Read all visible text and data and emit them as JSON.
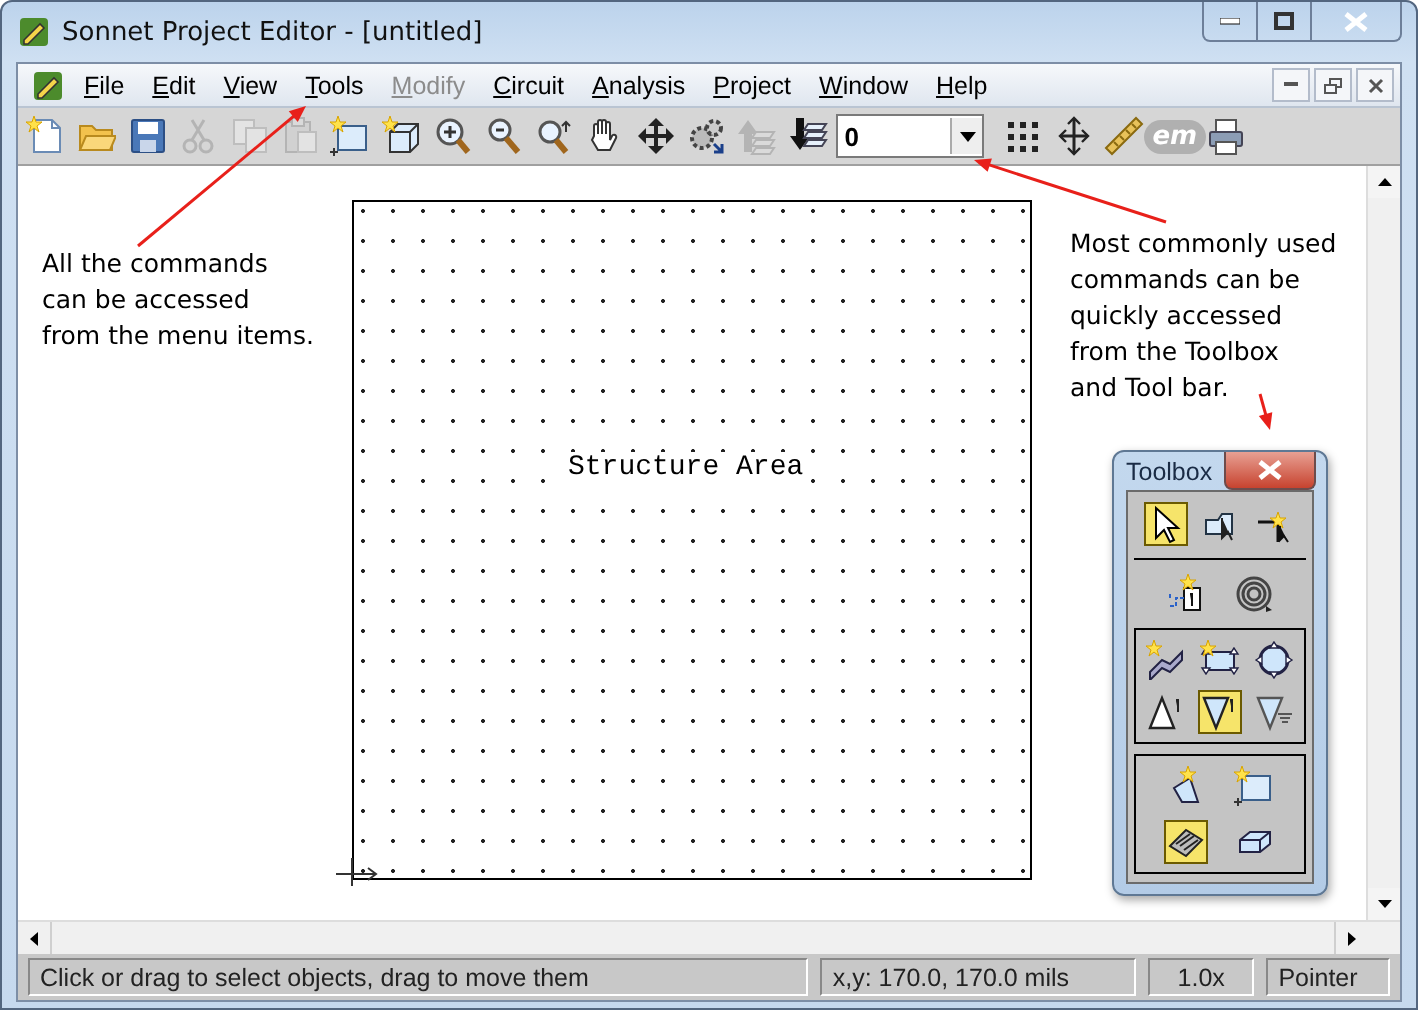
{
  "window": {
    "title": "Sonnet Project Editor - [untitled]"
  },
  "menu": [
    {
      "label": "File",
      "disabled": false
    },
    {
      "label": "Edit",
      "disabled": false
    },
    {
      "label": "View",
      "disabled": false
    },
    {
      "label": "Tools",
      "disabled": false
    },
    {
      "label": "Modify",
      "disabled": true
    },
    {
      "label": "Circuit",
      "disabled": false
    },
    {
      "label": "Analysis",
      "disabled": false
    },
    {
      "label": "Project",
      "disabled": false
    },
    {
      "label": "Window",
      "disabled": false
    },
    {
      "label": "Help",
      "disabled": false
    }
  ],
  "toolbar": [
    {
      "kind": "new",
      "disabled": false
    },
    {
      "kind": "open",
      "disabled": false
    },
    {
      "kind": "save",
      "disabled": false
    },
    {
      "kind": "cut",
      "disabled": true
    },
    {
      "kind": "copy",
      "disabled": true
    },
    {
      "kind": "paste",
      "disabled": true
    },
    {
      "kind": "add-rect",
      "disabled": false
    },
    {
      "kind": "add-box",
      "disabled": false
    },
    {
      "kind": "zoom-in",
      "disabled": false
    },
    {
      "kind": "zoom-out",
      "disabled": false
    },
    {
      "kind": "zoom-fit",
      "disabled": false
    },
    {
      "kind": "pan",
      "disabled": false
    },
    {
      "kind": "move",
      "disabled": false
    },
    {
      "kind": "gears",
      "disabled": false
    },
    {
      "kind": "level-up",
      "disabled": true
    },
    {
      "kind": "level-down",
      "disabled": false
    },
    {
      "kind": "level",
      "value": "0"
    },
    {
      "kind": "grid",
      "disabled": false
    },
    {
      "kind": "snap",
      "disabled": false
    },
    {
      "kind": "ruler",
      "disabled": false
    },
    {
      "kind": "em",
      "label": "em",
      "disabled": true
    },
    {
      "kind": "print",
      "disabled": false
    }
  ],
  "structure": {
    "label": "Structure Area"
  },
  "annotations": [
    "All the commands\ncan be accessed\nfrom the menu items.",
    "Most commonly used\ncommands can be\nquickly accessed\nfrom the Toolbox\nand Tool bar."
  ],
  "toolbox": {
    "title": "Toolbox",
    "groups": [
      {
        "kind": "plain",
        "tools": [
          {
            "kind": "pointer",
            "selected": true
          },
          {
            "kind": "reshape",
            "selected": false
          },
          {
            "kind": "via",
            "selected": false
          }
        ]
      },
      {
        "kind": "plain",
        "tools": [
          {
            "kind": "port",
            "selected": false
          },
          {
            "kind": "spiral",
            "selected": false
          }
        ]
      },
      {
        "kind": "boxed",
        "tools": [
          {
            "kind": "metal",
            "selected": false
          },
          {
            "kind": "rect-handles",
            "selected": false
          },
          {
            "kind": "circle-handles",
            "selected": false
          },
          {
            "kind": "tri-up",
            "selected": false
          },
          {
            "kind": "tri-down",
            "selected": true
          },
          {
            "kind": "tri-ground",
            "selected": false
          }
        ]
      },
      {
        "kind": "boxed",
        "tools": [
          {
            "kind": "add-poly",
            "selected": false
          },
          {
            "kind": "add-rect",
            "selected": false
          },
          {
            "kind": "hatched",
            "selected": true
          },
          {
            "kind": "brick",
            "selected": false
          }
        ]
      }
    ]
  },
  "status_bar": {
    "message": "Click or drag to select objects, drag to move them",
    "coordinates": "x,y: 170.0, 170.0 mils",
    "zoom": "1.0x",
    "mode": "Pointer"
  }
}
